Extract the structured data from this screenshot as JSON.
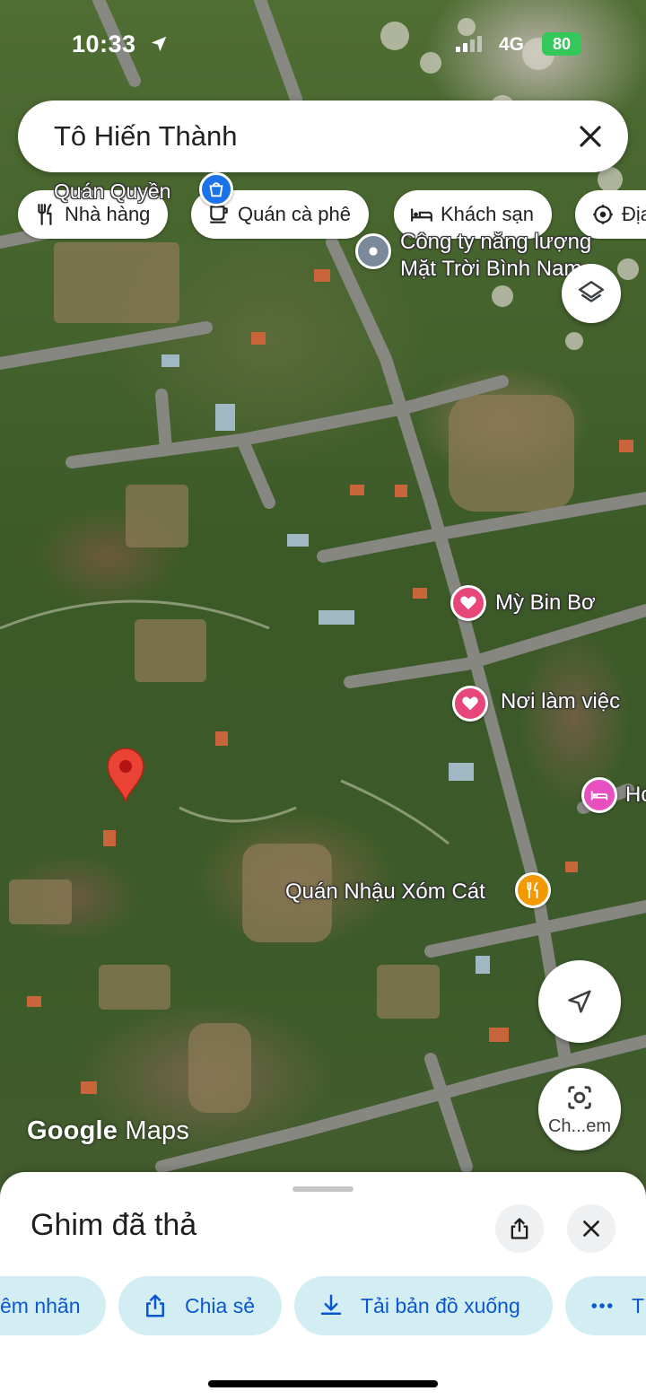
{
  "status_bar": {
    "time": "10:33",
    "network": "4G",
    "battery": "80"
  },
  "search": {
    "query": "Tô Hiến Thành"
  },
  "chips": [
    {
      "label": "Nhà hàng",
      "icon": "restaurant-icon"
    },
    {
      "label": "Quán cà phê",
      "icon": "coffee-icon"
    },
    {
      "label": "Khách sạn",
      "icon": "hotel-icon"
    },
    {
      "label": "Địa",
      "icon": "attraction-icon"
    }
  ],
  "map_labels": {
    "quan_quyen": "Quán Quyền",
    "company_line1": "Công ty năng lượng",
    "company_line2": "Mặt Trời Bình Nam",
    "my_bin_bo": "Mỳ Bin Bơ",
    "noi_lam_viec": "Nơi làm việc",
    "hotel_partial": "Ho",
    "quan_nhau": "Quán Nhậu Xóm Cát"
  },
  "logo": {
    "google": "Google",
    "maps": "Maps"
  },
  "lens": {
    "caption": "Ch...em"
  },
  "sheet": {
    "title": "Ghim đã thả",
    "actions": [
      {
        "label": "êm nhãn",
        "icon": "label-icon"
      },
      {
        "label": "Chia sẻ",
        "icon": "share-icon"
      },
      {
        "label": "Tải bản đồ xuống",
        "icon": "download-icon"
      },
      {
        "label": "T",
        "icon": "more-icon"
      }
    ]
  },
  "colors": {
    "accent": "#0b57d0",
    "chip_bg": "#d3eef3",
    "pin": "#ea4335",
    "favorite": "#e8457a",
    "hotel": "#e84fbf",
    "food": "#f29900",
    "transit": "#1a73e8"
  }
}
